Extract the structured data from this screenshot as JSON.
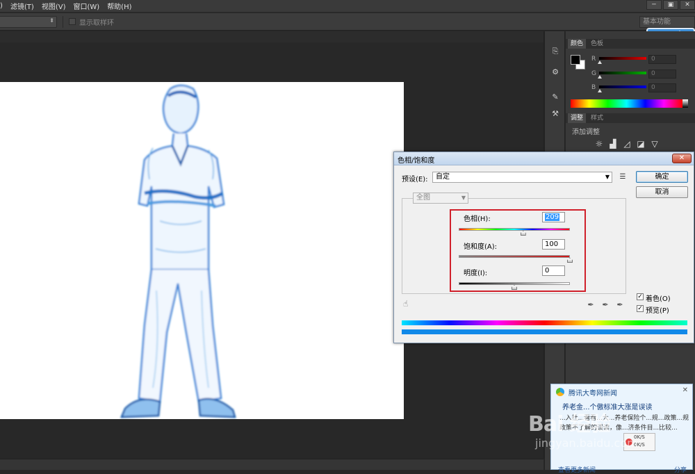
{
  "menubar": {
    "items": [
      "滤镜(T)",
      "视图(V)",
      "窗口(W)",
      "帮助(H)"
    ],
    "window_controls": [
      "─",
      "▣",
      "✕"
    ]
  },
  "options_bar": {
    "show_sample_ring": "显示取样环",
    "workspace": "基本功能"
  },
  "cloud_badge": "云盘",
  "color_panel": {
    "tabs": [
      "颜色",
      "色板"
    ],
    "channels": [
      {
        "label": "R",
        "value": "0",
        "color": "#e00000"
      },
      {
        "label": "G",
        "value": "0",
        "color": "#00b000"
      },
      {
        "label": "B",
        "value": "0",
        "color": "#0000e0"
      }
    ],
    "foreground": "#000000",
    "background": "#ffffff"
  },
  "adjust_panel": {
    "tabs": [
      "调整",
      "样式"
    ],
    "title": "添加调整",
    "icons": [
      "brightness-icon",
      "levels-icon",
      "curves-icon",
      "exposure-icon",
      "vibrance-icon"
    ]
  },
  "dialog": {
    "title": "色相/饱和度",
    "close": "✕",
    "preset_label": "预设(E):",
    "preset_value": "自定",
    "ok": "确定",
    "cancel": "取消",
    "range": "全图",
    "hue_label": "色相(H):",
    "hue_value": "209",
    "hue_fraction": 0.58,
    "saturation_label": "饱和度(A):",
    "saturation_value": "100",
    "saturation_fraction": 1.0,
    "lightness_label": "明度(I):",
    "lightness_value": "0",
    "lightness_fraction": 0.5,
    "colorize_label": "着色(O)",
    "preview_label": "预览(P)",
    "colorize_checked": true,
    "preview_checked": true
  },
  "news": {
    "source": "腾讯大粤网新闻",
    "headline": "养老金...个傲标准大涨是误读",
    "body": "...入社...看看...大...养老保险个...规...政策...规政策不了解的误读，像...济条件目...比较...",
    "speed_up": "0K/S",
    "speed_down": "0K/S",
    "footer": "查看更多新闻",
    "share": "分享"
  },
  "watermark": {
    "brand": "Bai 经验",
    "sub": "jingyan.baidu.com"
  }
}
